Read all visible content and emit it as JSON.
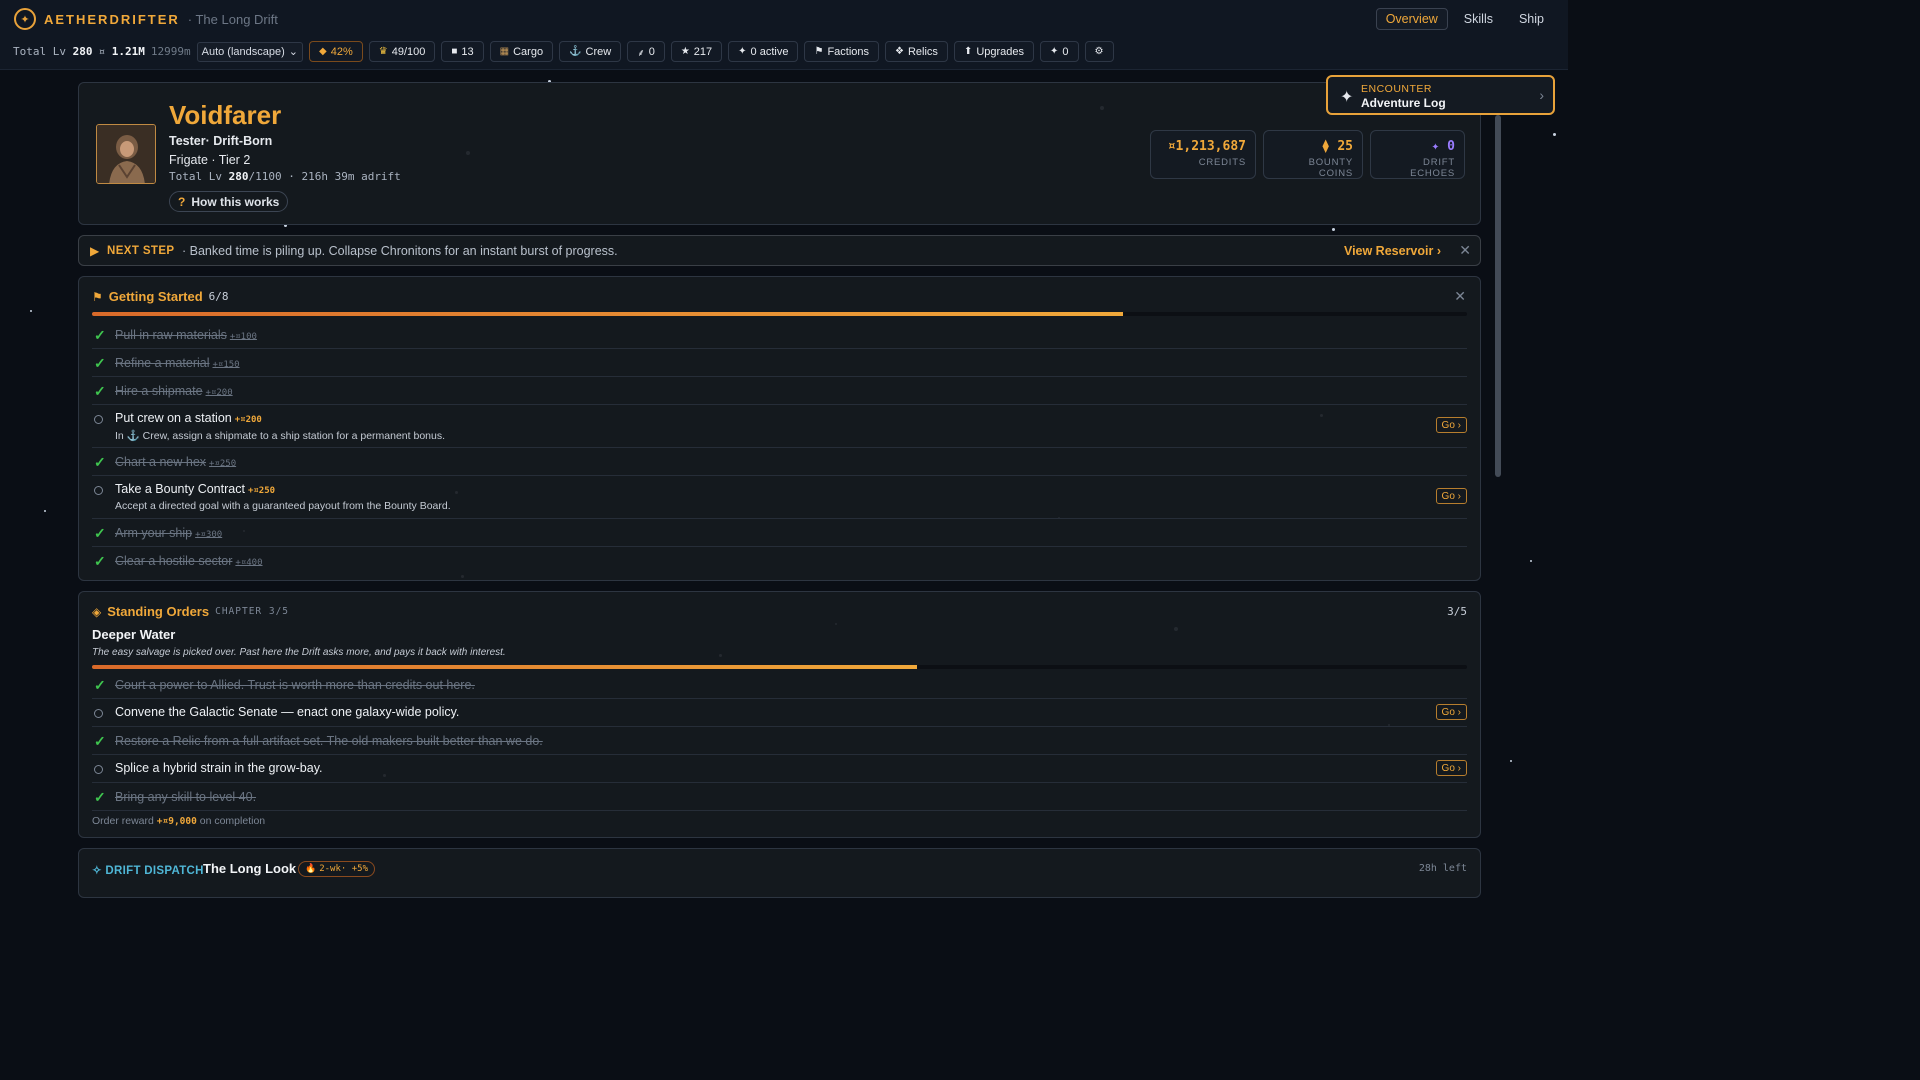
{
  "app": {
    "name": "AETHERDRIFTER",
    "subtitle": "· The Long Drift"
  },
  "nav": {
    "tabs": [
      {
        "label": "Overview",
        "active": true
      },
      {
        "label": "Skills",
        "active": false
      },
      {
        "label": "Ship",
        "active": false
      }
    ]
  },
  "statusbar": {
    "total_lv_label": "Total Lv",
    "total_lv_value": "280",
    "credits_icon": "¤",
    "credits_short": "1.21M",
    "time": "12999m",
    "mode_select": "Auto (landscape)",
    "pills": [
      {
        "icon": "◆",
        "label": "42%",
        "warn": true,
        "icon_name": "diamond-icon"
      },
      {
        "icon": "🏆",
        "label": "49/100",
        "warn": false,
        "icon_name": "trophy-icon"
      },
      {
        "icon": "■",
        "label": "13",
        "warn": false,
        "icon_name": "card-icon"
      },
      {
        "icon": "▦",
        "label": "Cargo",
        "warn": false,
        "icon_name": "cargo-icon"
      },
      {
        "icon": "⚓",
        "label": "Crew",
        "warn": false,
        "icon_name": "anchor-icon"
      },
      {
        "icon": "⸙",
        "label": "0",
        "warn": false,
        "icon_name": "leaf-icon"
      },
      {
        "icon": "★",
        "label": "217",
        "warn": false,
        "icon_name": "star-icon"
      },
      {
        "icon": "✦",
        "label": "0 active",
        "warn": false,
        "icon_name": "sparkle-icon"
      },
      {
        "icon": "⚑",
        "label": "Factions",
        "warn": false,
        "icon_name": "flag-icon"
      },
      {
        "icon": "❖",
        "label": "Relics",
        "warn": false,
        "icon_name": "relic-icon"
      },
      {
        "icon": "⬆",
        "label": "Upgrades",
        "warn": false,
        "icon_name": "upgrade-icon"
      },
      {
        "icon": "✦",
        "label": "0",
        "warn": false,
        "icon_name": "sparkle-icon"
      },
      {
        "icon": "⚙",
        "label": "",
        "warn": false,
        "icon_name": "gear-icon"
      }
    ]
  },
  "hero": {
    "name": "Voidfarer",
    "title": "Tester· Drift-Born",
    "ship": "Frigate · Tier 2",
    "total_lv_prefix": "Total Lv ",
    "total_lv_value": "280",
    "total_lv_suffix": "/1100 · 216h 39m adrift",
    "how_label": "How this works",
    "currencies": [
      {
        "value": "¤1,213,687",
        "label": "CREDITS",
        "color": "#f0a83a"
      },
      {
        "value": "⧫ 25",
        "label": "BOUNTY COINS",
        "color": "#f0a83a"
      },
      {
        "value": "✦ 0",
        "label": "DRIFT ECHOES",
        "color": "#9a7cff"
      }
    ]
  },
  "encounter": {
    "kicker": "ENCOUNTER",
    "title": "Adventure Log"
  },
  "next_step": {
    "label": "NEXT STEP",
    "text": "· Banked time is piling up. Collapse Chronitons for an instant burst of progress.",
    "link": "View Reservoir ›"
  },
  "getting_started": {
    "title": "Getting Started",
    "count": "6/8",
    "progress": 0.75,
    "items": [
      {
        "label": "Pull in raw materials",
        "reward": "+¤100",
        "done": true
      },
      {
        "label": "Refine a material",
        "reward": "+¤150",
        "done": true
      },
      {
        "label": "Hire a shipmate",
        "reward": "+¤200",
        "done": true
      },
      {
        "label": "Put crew on a station",
        "reward": "+¤200",
        "done": false,
        "sub": "In ⚓ Crew, assign a shipmate to a ship station for a permanent bonus.",
        "go": "Go ›"
      },
      {
        "label": "Chart a new hex",
        "reward": "+¤250",
        "done": true
      },
      {
        "label": "Take a Bounty Contract",
        "reward": "+¤250",
        "done": false,
        "sub": "Accept a directed goal with a guaranteed payout from the Bounty Board.",
        "go": "Go ›"
      },
      {
        "label": "Arm your ship",
        "reward": "+¤300",
        "done": true
      },
      {
        "label": "Clear a hostile sector",
        "reward": "+¤400",
        "done": true
      }
    ]
  },
  "standing_orders": {
    "title": "Standing Orders",
    "chapter": "CHAPTER 3/5",
    "count": "3/5",
    "name": "Deeper Water",
    "description": "The easy salvage is picked over. Past here the Drift asks more, and pays it back with interest.",
    "progress": 0.6,
    "items": [
      {
        "label": "Court a power to Allied. Trust is worth more than credits out here.",
        "done": true
      },
      {
        "label": "Convene the Galactic Senate — enact one galaxy-wide policy.",
        "done": false,
        "go": "Go ›"
      },
      {
        "label": "Restore a Relic from a full artifact set. The old makers built better than we do.",
        "done": true
      },
      {
        "label": "Splice a hybrid strain in the grow-bay.",
        "done": false,
        "go": "Go ›"
      },
      {
        "label": "Bring any skill to level 40.",
        "done": true
      }
    ],
    "reward_prefix": "Order reward",
    "reward_value": "+¤9,000",
    "reward_suffix": "on completion"
  },
  "dispatch": {
    "label": "✧ DRIFT DISPATCH",
    "title": "The Long Look",
    "badge": "2-wk· +5%",
    "time_left": "28h left"
  }
}
